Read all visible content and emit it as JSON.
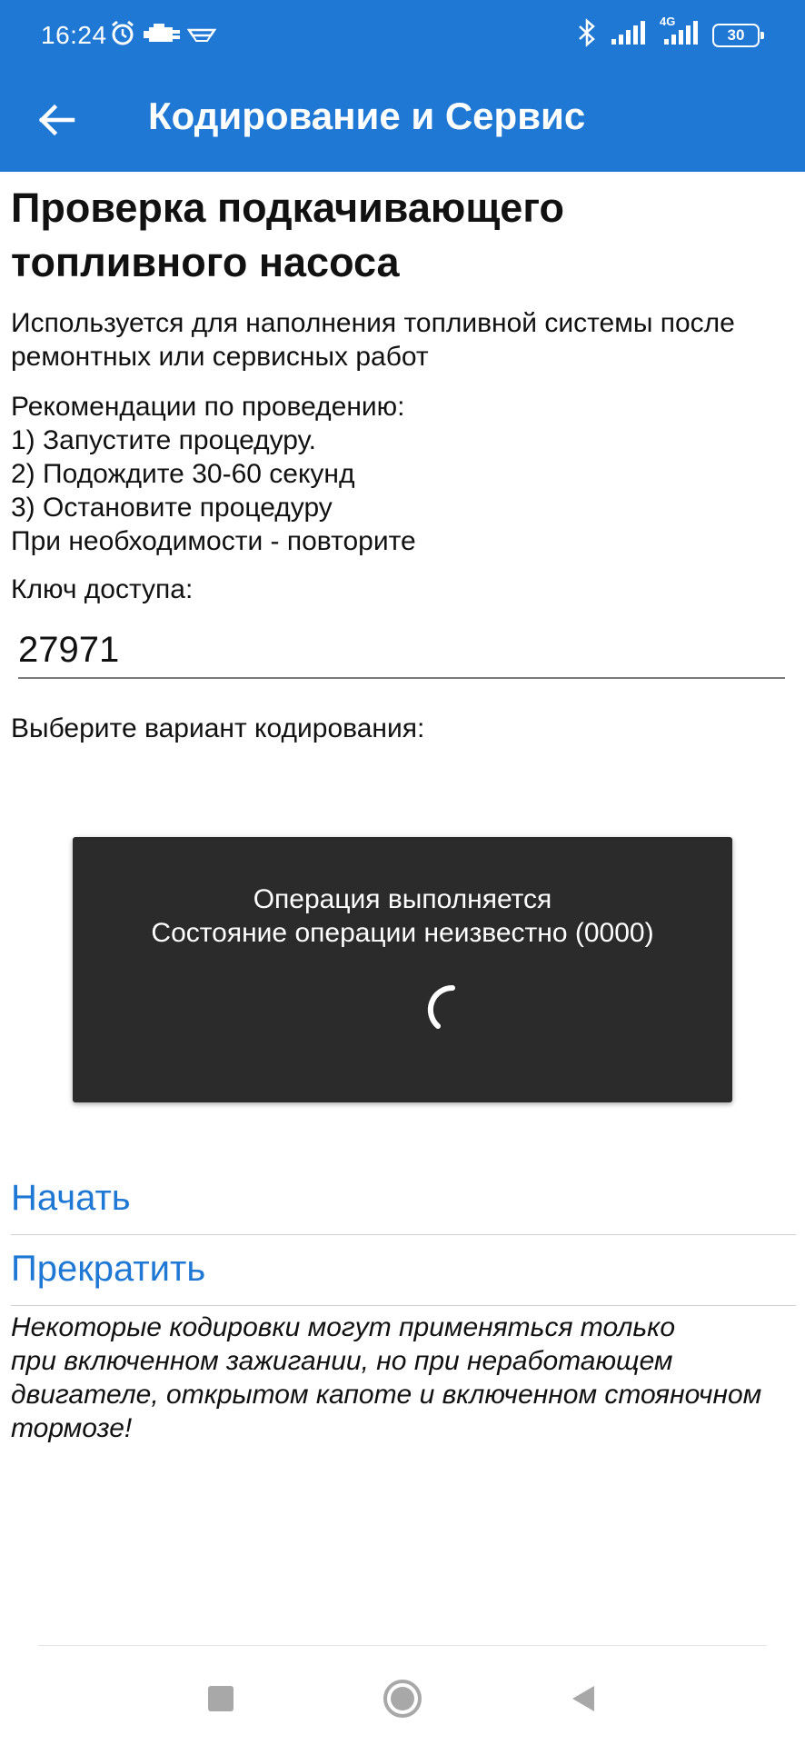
{
  "status_bar": {
    "time": "16:24",
    "battery": "30",
    "network": "4G",
    "left_icons": [
      "alarm-icon",
      "check-engine-icon",
      "car-icon"
    ],
    "right_icons": [
      "bluetooth-icon",
      "signal-icon",
      "signal-4g-icon",
      "battery-icon"
    ]
  },
  "toolbar": {
    "title": "Кодирование и Сервис",
    "back_icon": "arrow-back-icon",
    "background": "#1f78d4"
  },
  "content": {
    "title_line1": "Проверка подкачивающего",
    "title_line2": "топливного насоса",
    "description_line1": "Используется для наполнения топливной системы после",
    "description_line2": "ремонтных или сервисных работ",
    "recommendations": [
      "Рекомендации по проведению:",
      "1) Запустите процедуру.",
      "2) Подождите 30-60 секунд",
      "3) Остановите процедуру",
      "При необходимости - повторите"
    ],
    "access_key_label": "Ключ доступа:",
    "access_key_value": "27971",
    "choose_variant_label": "Выберите вариант кодирования:"
  },
  "dialog": {
    "line1": "Операция выполняется",
    "line2": "Состояние операции неизвестно (0000)",
    "background": "#2b2b2b"
  },
  "actions": {
    "start": "Начать",
    "stop": "Прекратить",
    "link_color": "#1f78d4"
  },
  "warning": {
    "line1": "Некоторые кодировки могут применяться только",
    "line2": "при включенном зажигании, но при неработающем",
    "line3": "двигателе, открытом капоте и включенном стояночном",
    "line4": "тормозе!"
  },
  "nav_bar": {
    "buttons": [
      "recents-square-icon",
      "home-circle-icon",
      "back-triangle-icon"
    ]
  }
}
